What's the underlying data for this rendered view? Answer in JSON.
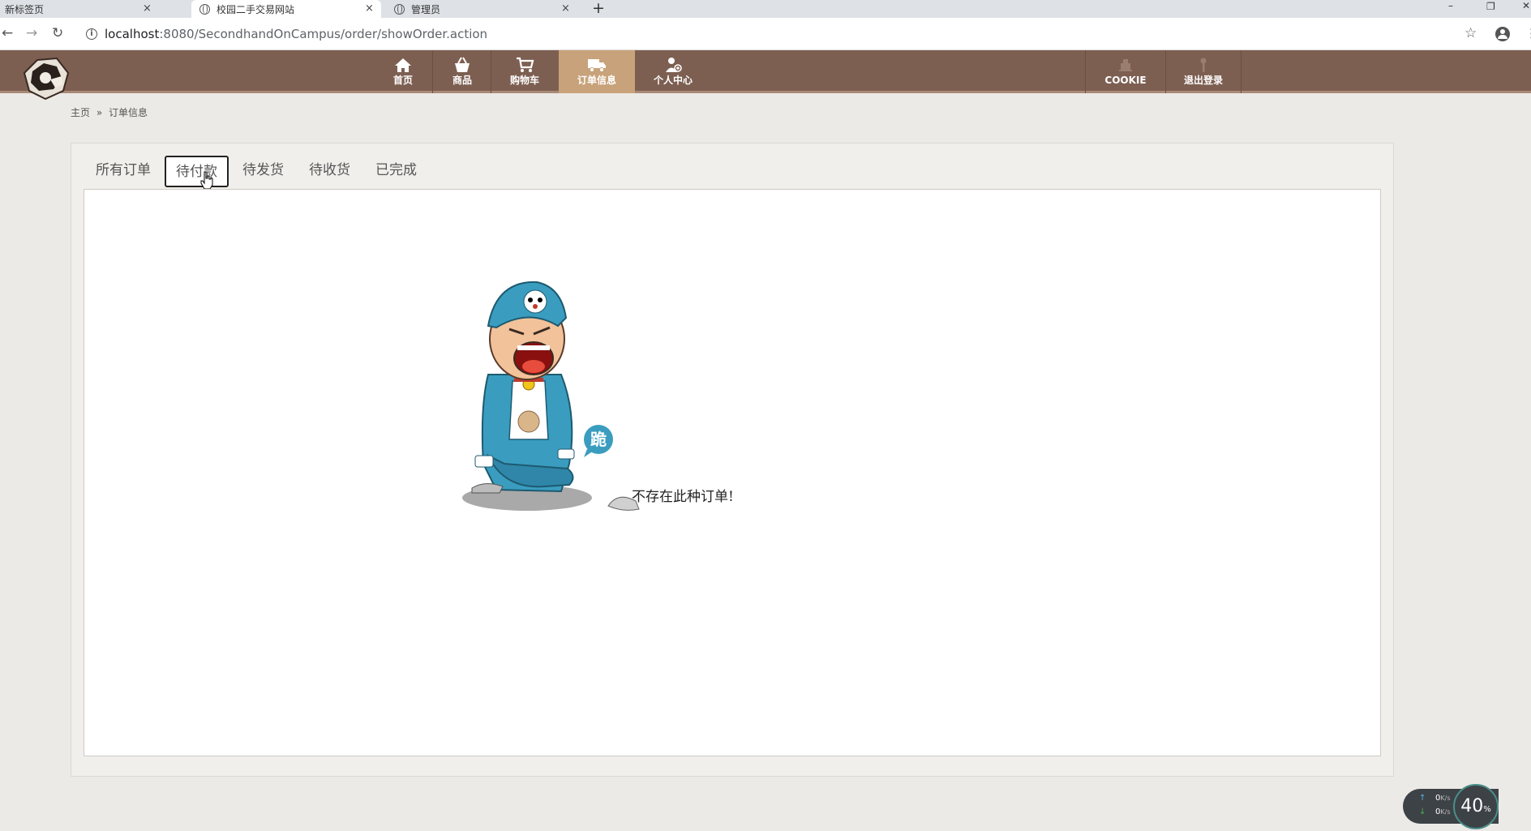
{
  "browser": {
    "tabs": [
      {
        "title": "新标签页",
        "active": false
      },
      {
        "title": "校园二手交易网站",
        "active": true
      },
      {
        "title": "管理员",
        "active": false
      }
    ],
    "close_glyph": "×",
    "new_tab_glyph": "+",
    "window_controls": {
      "minimize": "–",
      "restore": "❐",
      "close": "✕"
    },
    "url_host": "localhost",
    "url_path": ":8080/SecondhandOnCampus/order/showOrder.action",
    "nav_icons": {
      "back": "←",
      "forward": "→",
      "reload": "↻"
    }
  },
  "site": {
    "nav": [
      {
        "label": "首页",
        "icon": "home-icon"
      },
      {
        "label": "商品",
        "icon": "basket-icon"
      },
      {
        "label": "购物车",
        "icon": "cart-icon"
      },
      {
        "label": "订单信息",
        "icon": "truck-icon",
        "active": true
      },
      {
        "label": "个人中心",
        "icon": "user-add-icon"
      }
    ],
    "nav_right": [
      {
        "label": "COOKIE",
        "icon": "cookie-icon"
      },
      {
        "label": "退出登录",
        "icon": "key-icon"
      }
    ],
    "colors": {
      "navbar": "#7d5f52",
      "active": "#c8a27a"
    }
  },
  "breadcrumb": {
    "home": "主页",
    "separator": "»",
    "current": "订单信息"
  },
  "order_tabs": [
    {
      "label": "所有订单"
    },
    {
      "label": "待付款",
      "selected": true
    },
    {
      "label": "待发货"
    },
    {
      "label": "待收货"
    },
    {
      "label": "已完成"
    }
  ],
  "empty_state": {
    "message": "不存在此种订单!",
    "badge": "跪"
  },
  "speed_widget": {
    "up": "0",
    "down": "0",
    "unit": "K/s",
    "percent": "40",
    "percent_unit": "%"
  }
}
